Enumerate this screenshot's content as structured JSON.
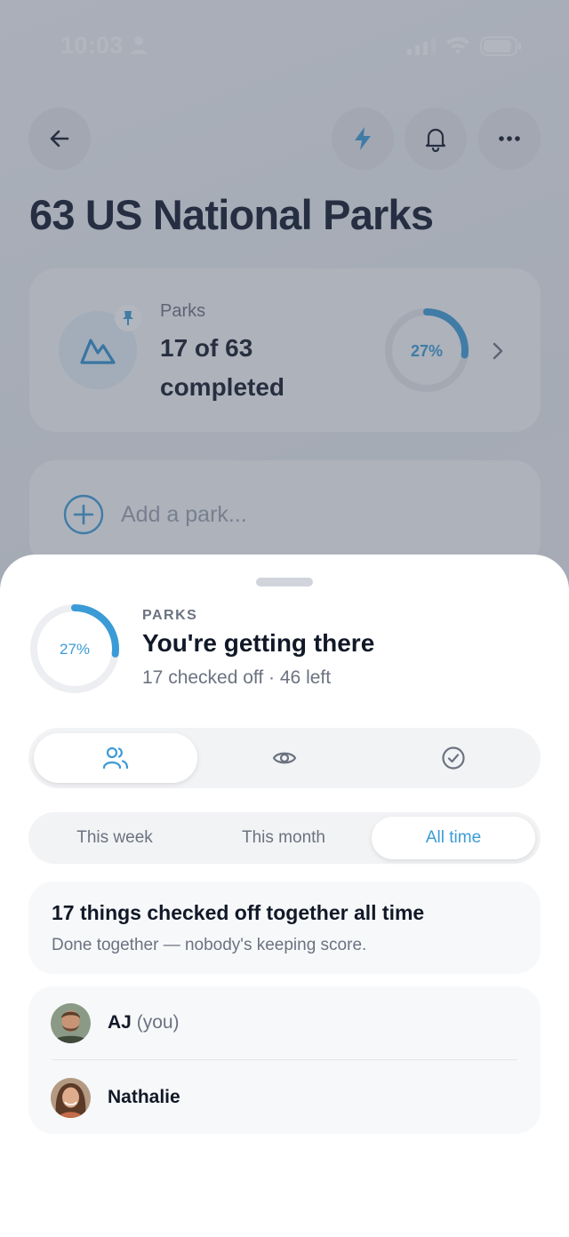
{
  "status_bar": {
    "time": "10:03"
  },
  "page": {
    "title": "63 US National Parks",
    "summary": {
      "label": "Parks",
      "value": "17 of 63 completed",
      "percent_label": "27%",
      "progress": 0.27
    },
    "add_placeholder": "Add a park..."
  },
  "sheet": {
    "eyebrow": "PARKS",
    "heading": "You're getting there",
    "subtitle": "17 checked off · 46 left",
    "percent_label": "27%",
    "progress": 0.27,
    "view_tabs": [
      {
        "icon": "people-icon",
        "active": true
      },
      {
        "icon": "eye-icon",
        "active": false
      },
      {
        "icon": "check-circle-icon",
        "active": false
      }
    ],
    "time_tabs": [
      {
        "label": "This week",
        "active": false
      },
      {
        "label": "This month",
        "active": false
      },
      {
        "label": "All time",
        "active": true
      }
    ],
    "info": {
      "title": "17 things checked off together all time",
      "subtitle": "Done together — nobody's keeping score."
    },
    "members": [
      {
        "name": "AJ",
        "suffix": "(you)"
      },
      {
        "name": "Nathalie",
        "suffix": ""
      }
    ]
  },
  "colors": {
    "accent": "#3b9bd6",
    "overlay": "#485264"
  }
}
